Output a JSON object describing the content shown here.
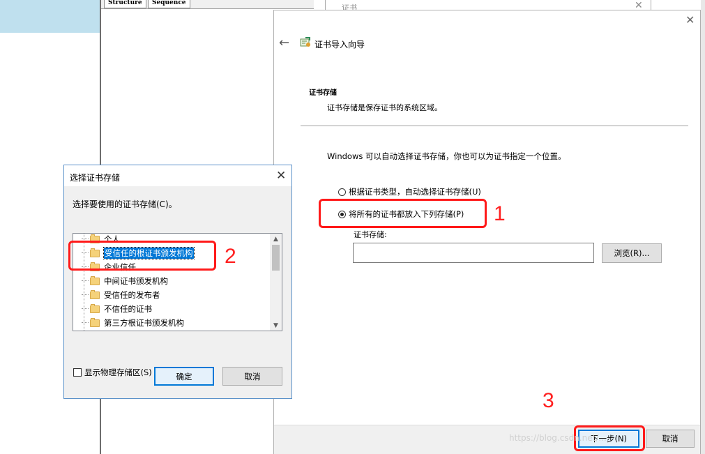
{
  "background": {
    "tabs": [
      "Structure",
      "Sequence"
    ],
    "cert_window_title": "证书",
    "cert_window_close": "✕"
  },
  "wizard": {
    "title": "证书导入向导",
    "back": "←",
    "close": "✕",
    "section_title": "证书存储",
    "section_desc": "证书存储是保存证书的系统区域。",
    "info": "Windows 可以自动选择证书存储，你也可以为证书指定一个位置。",
    "radio_auto": "根据证书类型，自动选择证书存储(U)",
    "radio_manual": "将所有的证书都放入下列存储(P)",
    "selected_radio": "manual",
    "store_label": "证书存储:",
    "store_value": "",
    "browse": "浏览(R)...",
    "next": "下一步(N)",
    "cancel": "取消"
  },
  "dialog": {
    "title": "选择证书存储",
    "close": "✕",
    "prompt": "选择要使用的证书存储(C)。",
    "stores": [
      "个人",
      "受信任的根证书颁发机构",
      "企业信任",
      "中间证书颁发机构",
      "受信任的发布者",
      "不信任的证书",
      "第三方根证书颁发机构"
    ],
    "selected_store": "受信任的根证书颁发机构",
    "show_physical": "显示物理存储区(S)",
    "ok": "确定",
    "cancel": "取消"
  },
  "annotations": [
    "1",
    "2",
    "3"
  ],
  "watermark": "https://blog.csdn.net/...",
  "colors": {
    "annotation": "#ff1a1a",
    "selection": "#0078d7"
  }
}
